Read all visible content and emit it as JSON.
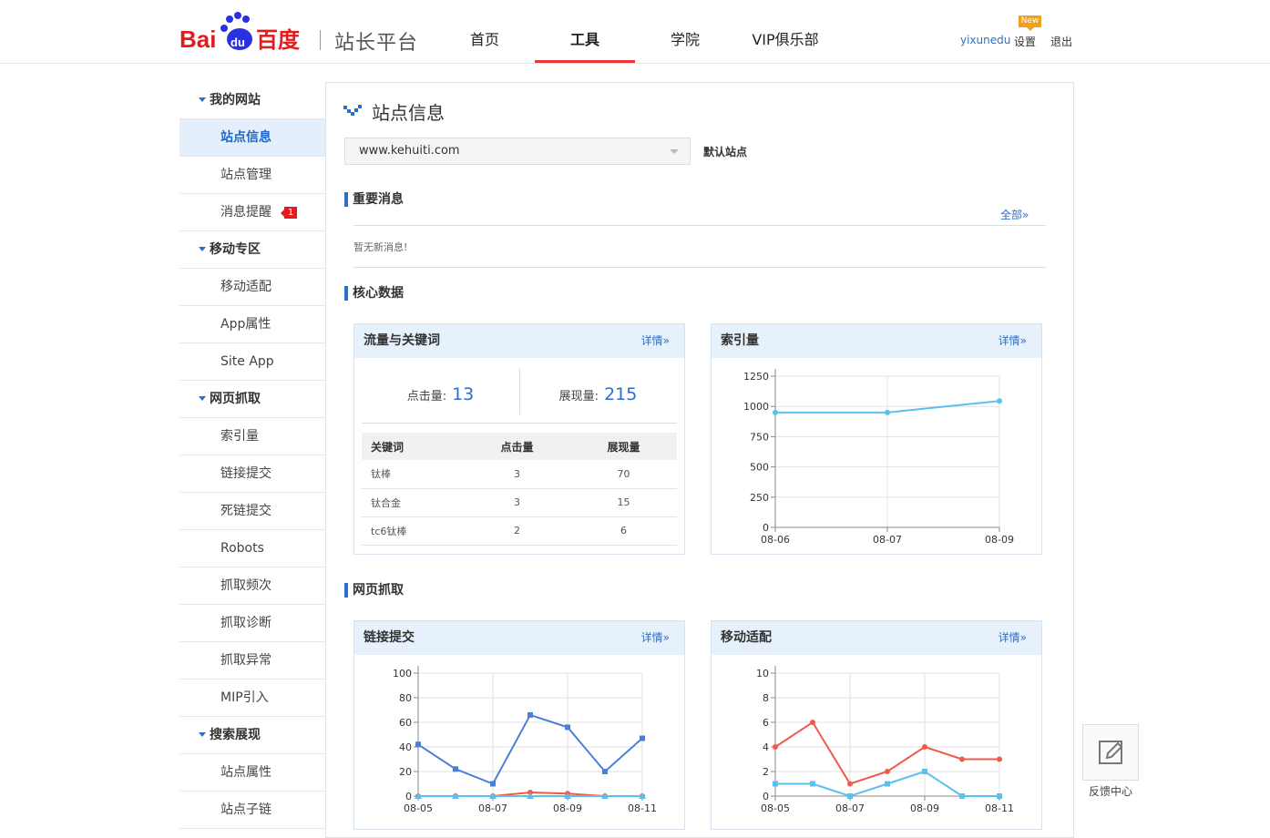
{
  "header": {
    "logo_alt": "Bai du 百度",
    "platform_name": "站长平台",
    "nav": [
      {
        "label": "首页",
        "active": false
      },
      {
        "label": "工具",
        "active": true
      },
      {
        "label": "学院",
        "active": false
      },
      {
        "label": "VIP俱乐部",
        "active": false
      }
    ],
    "username": "yixunedu",
    "settings": "设置",
    "new_badge": "New",
    "logout": "退出"
  },
  "sidebar": {
    "groups": [
      {
        "label": "我的网站",
        "items": [
          {
            "label": "站点信息",
            "active": true
          },
          {
            "label": "站点管理"
          },
          {
            "label": "消息提醒",
            "badge": "1"
          }
        ]
      },
      {
        "label": "移动专区",
        "items": [
          {
            "label": "移动适配"
          },
          {
            "label": "App属性"
          },
          {
            "label": "Site App"
          }
        ]
      },
      {
        "label": "网页抓取",
        "items": [
          {
            "label": "索引量"
          },
          {
            "label": "链接提交"
          },
          {
            "label": "死链提交"
          },
          {
            "label": "Robots"
          },
          {
            "label": "抓取频次"
          },
          {
            "label": "抓取诊断"
          },
          {
            "label": "抓取异常"
          },
          {
            "label": "MIP引入"
          }
        ]
      },
      {
        "label": "搜索展现",
        "items": [
          {
            "label": "站点属性"
          },
          {
            "label": "站点子链"
          }
        ]
      }
    ]
  },
  "main": {
    "title": "站点信息",
    "site_select_value": "www.kehuiti.com",
    "default_site": "默认站点",
    "important_msgs": {
      "title": "重要消息",
      "all_link": "全部»",
      "empty_text": "暂无新消息!"
    },
    "core_data": {
      "title": "核心数据"
    },
    "crawl": {
      "title": "网页抓取"
    },
    "traffic_card": {
      "title": "流量与关键词",
      "detail": "详情»",
      "clicks_label": "点击量:",
      "clicks": "13",
      "impressions_label": "展现量:",
      "impressions": "215",
      "columns": [
        "关键词",
        "点击量",
        "展现量"
      ],
      "rows": [
        [
          "钛棒",
          "3",
          "70"
        ],
        [
          "钛合金",
          "3",
          "15"
        ],
        [
          "tc6钛棒",
          "2",
          "6"
        ]
      ]
    },
    "index_card": {
      "title": "索引量",
      "detail": "详情»"
    },
    "link_card": {
      "title": "链接提交",
      "detail": "详情»"
    },
    "mobile_card": {
      "title": "移动适配",
      "detail": "详情»"
    }
  },
  "feedback": {
    "label": "反馈中心"
  },
  "colors": {
    "accent": "#2b6fc7",
    "nav_active": "#e5383b",
    "series_blue": "#4a7fd9",
    "series_light": "#5bc0f0",
    "series_red": "#f05a4a"
  },
  "chart_data": [
    {
      "id": "index",
      "type": "line",
      "title": "索引量",
      "x": [
        "08-06",
        "08-07",
        "08-09"
      ],
      "series": [
        {
          "values": [
            950,
            950,
            1045
          ]
        }
      ],
      "yticks": [
        0,
        250,
        500,
        750,
        1000,
        1250
      ],
      "ylim": [
        0,
        1250
      ],
      "grid": true
    },
    {
      "id": "links",
      "type": "line",
      "title": "链接提交",
      "x": [
        "08-05",
        "08-06",
        "08-07",
        "08-08",
        "08-09",
        "08-10",
        "08-11"
      ],
      "xticks": [
        "08-05",
        "08-07",
        "08-09",
        "08-11"
      ],
      "series": [
        {
          "values": [
            42,
            22,
            10,
            66,
            56,
            20,
            47
          ]
        },
        {
          "values": [
            0,
            0,
            0,
            3,
            2,
            0,
            0
          ]
        },
        {
          "values": [
            0,
            0,
            0,
            0,
            0,
            0,
            0
          ]
        }
      ],
      "yticks": [
        0,
        20,
        40,
        60,
        80,
        100
      ],
      "ylim": [
        0,
        100
      ],
      "grid": true
    },
    {
      "id": "mobile",
      "type": "line",
      "title": "移动适配",
      "x": [
        "08-05",
        "08-06",
        "08-07",
        "08-08",
        "08-09",
        "08-10",
        "08-11"
      ],
      "xticks": [
        "08-05",
        "08-07",
        "08-09",
        "08-11"
      ],
      "series": [
        {
          "values": [
            4,
            6,
            1,
            2,
            4,
            3,
            3
          ]
        },
        {
          "values": [
            1,
            1,
            0,
            1,
            2,
            0,
            0
          ]
        }
      ],
      "yticks": [
        0,
        2,
        4,
        6,
        8,
        10
      ],
      "ylim": [
        0,
        10
      ],
      "grid": true
    }
  ]
}
